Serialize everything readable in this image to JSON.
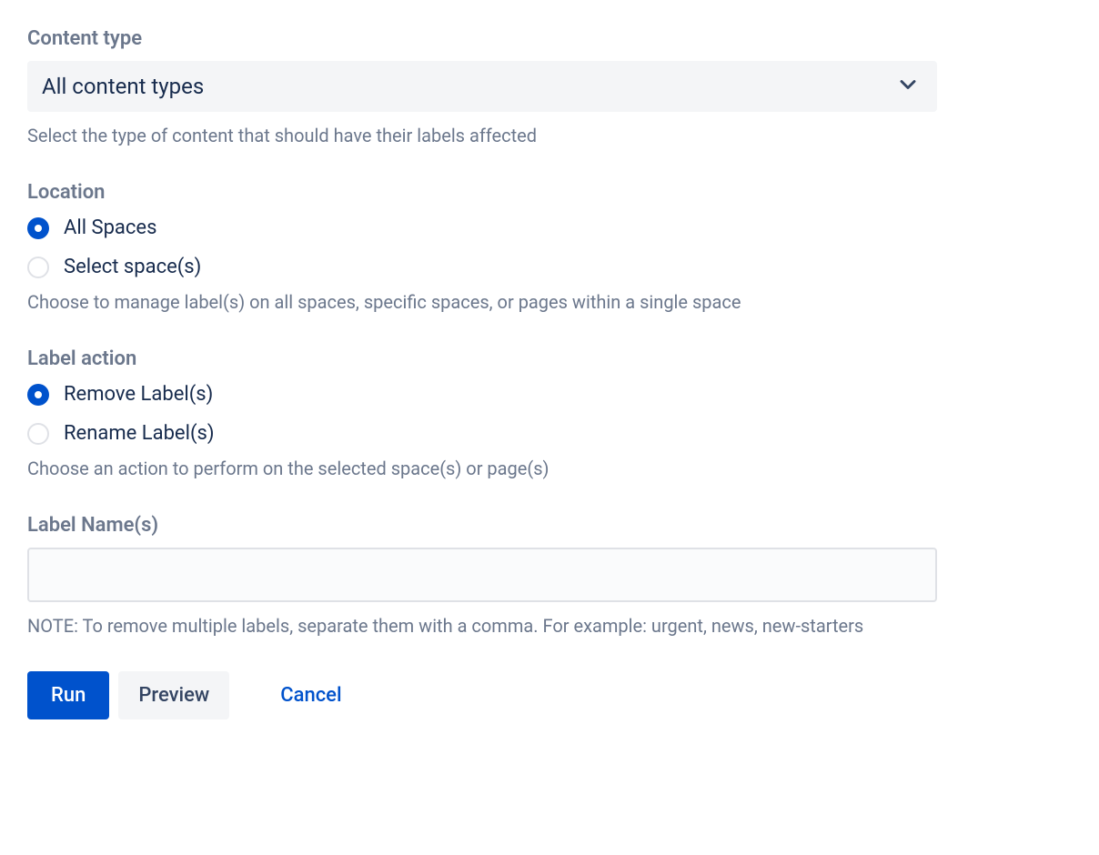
{
  "contentType": {
    "label": "Content type",
    "value": "All content types",
    "help": "Select the type of content that should have their labels affected"
  },
  "location": {
    "label": "Location",
    "options": [
      {
        "label": "All Spaces",
        "selected": true
      },
      {
        "label": "Select space(s)",
        "selected": false
      }
    ],
    "help": "Choose to manage label(s) on all spaces, specific spaces, or pages within a single space"
  },
  "labelAction": {
    "label": "Label action",
    "options": [
      {
        "label": "Remove Label(s)",
        "selected": true
      },
      {
        "label": "Rename Label(s)",
        "selected": false
      }
    ],
    "help": "Choose an action to perform on the selected space(s) or page(s)"
  },
  "labelNames": {
    "label": "Label Name(s)",
    "value": "",
    "help": "NOTE: To remove multiple labels, separate them with a comma. For example: urgent, news, new-starters"
  },
  "buttons": {
    "run": "Run",
    "preview": "Preview",
    "cancel": "Cancel"
  }
}
